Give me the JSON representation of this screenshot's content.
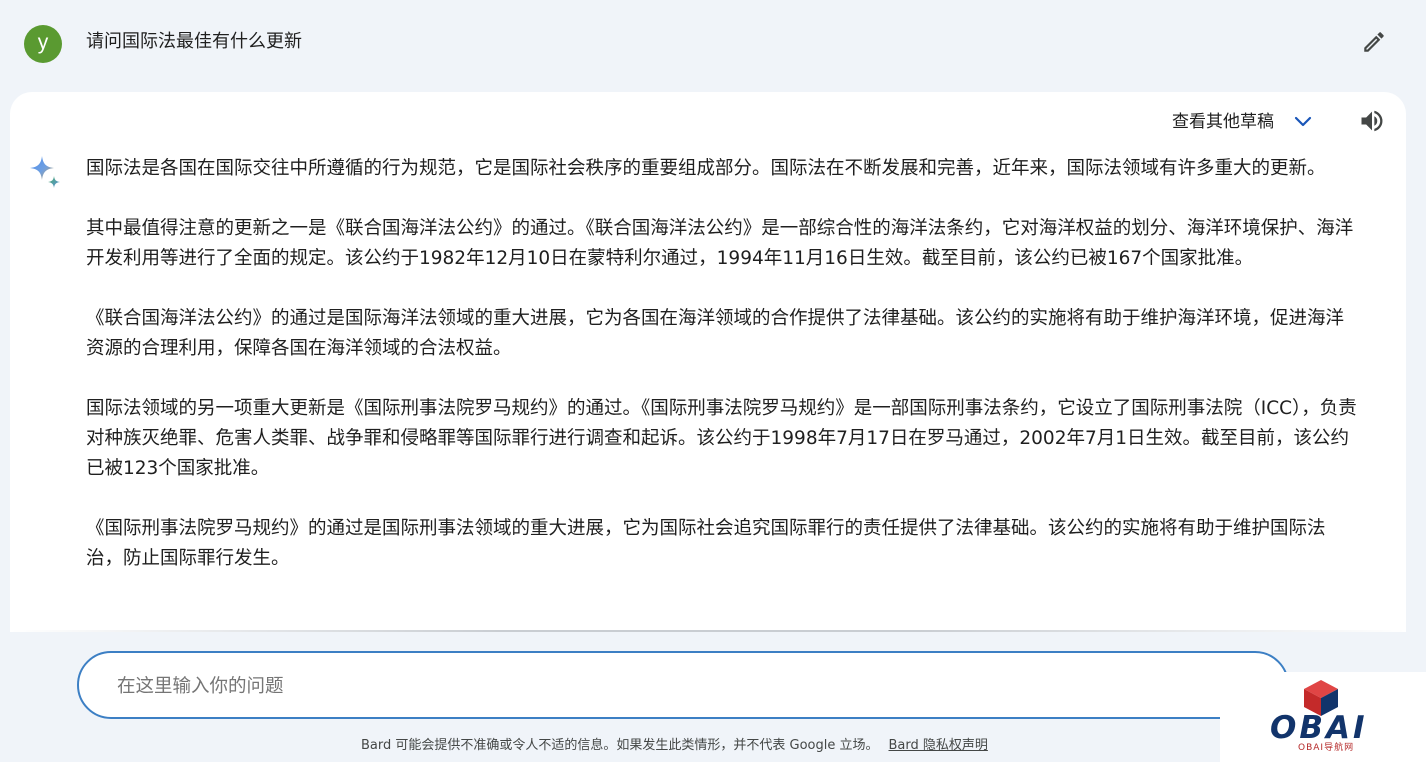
{
  "user": {
    "avatar_letter": "y",
    "query": "请问国际法最佳有什么更新"
  },
  "response": {
    "drafts_label": "查看其他草稿",
    "paragraphs": [
      "国际法是各国在国际交往中所遵循的行为规范，它是国际社会秩序的重要组成部分。国际法在不断发展和完善，近年来，国际法领域有许多重大的更新。",
      "其中最值得注意的更新之一是《联合国海洋法公约》的通过。《联合国海洋法公约》是一部综合性的海洋法条约，它对海洋权益的划分、海洋环境保护、海洋开发利用等进行了全面的规定。该公约于1982年12月10日在蒙特利尔通过，1994年11月16日生效。截至目前，该公约已被167个国家批准。",
      "《联合国海洋法公约》的通过是国际海洋法领域的重大进展，它为各国在海洋领域的合作提供了法律基础。该公约的实施将有助于维护海洋环境，促进海洋资源的合理利用，保障各国在海洋领域的合法权益。",
      "国际法领域的另一项重大更新是《国际刑事法院罗马规约》的通过。《国际刑事法院罗马规约》是一部国际刑事法条约，它设立了国际刑事法院（ICC），负责对种族灭绝罪、危害人类罪、战争罪和侵略罪等国际罪行进行调查和起诉。该公约于1998年7月17日在罗马通过，2002年7月1日生效。截至目前，该公约已被123个国家批准。",
      "《国际刑事法院罗马规约》的通过是国际刑事法领域的重大进展，它为国际社会追究国际罪行的责任提供了法律基础。该公约的实施将有助于维护国际法治，防止国际罪行发生。"
    ]
  },
  "input": {
    "placeholder": "在这里输入你的问题"
  },
  "footer": {
    "disclaimer": "Bard 可能会提供不准确或令人不适的信息。如果发生此类情形，并不代表 Google 立场。",
    "privacy_link": "Bard 隐私权声明"
  },
  "watermark": {
    "logo_text": "OBAI",
    "logo_subtext": "OBAI导航网"
  },
  "icons": {
    "edit": "pencil-icon",
    "drafts": "chevron-down-icon",
    "read_aloud": "speaker-icon",
    "bard": "sparkle-icon"
  },
  "colors": {
    "avatar": "#5a9a31",
    "accent": "#3c7fc4",
    "page_background": "#f0f4f9",
    "logo_navy": "#12346b",
    "logo_red": "#d03030"
  }
}
